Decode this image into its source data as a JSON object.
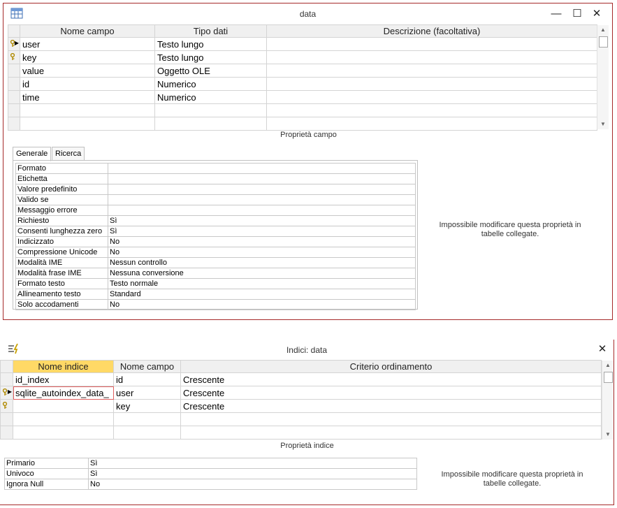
{
  "design_window": {
    "title": "data",
    "controls": {
      "minimize": "—",
      "maximize": "☐",
      "close": "✕"
    },
    "columns": [
      "Nome campo",
      "Tipo dati",
      "Descrizione (facoltativa)"
    ],
    "rows": [
      {
        "name": "user",
        "type": "Testo lungo",
        "desc": "",
        "key": true,
        "current": true
      },
      {
        "name": "key",
        "type": "Testo lungo",
        "desc": "",
        "key": true,
        "current": false
      },
      {
        "name": "value",
        "type": "Oggetto OLE",
        "desc": "",
        "key": false,
        "current": false
      },
      {
        "name": "id",
        "type": "Numerico",
        "desc": "",
        "key": false,
        "current": false
      },
      {
        "name": "time",
        "type": "Numerico",
        "desc": "",
        "key": false,
        "current": false
      },
      {
        "name": "",
        "type": "",
        "desc": "",
        "key": false,
        "current": false
      },
      {
        "name": "",
        "type": "",
        "desc": "",
        "key": false,
        "current": false
      }
    ],
    "section_label": "Proprietà campo",
    "tabs": [
      "Generale",
      "Ricerca"
    ],
    "properties": [
      [
        "Formato",
        ""
      ],
      [
        "Etichetta",
        ""
      ],
      [
        "Valore predefinito",
        ""
      ],
      [
        "Valido se",
        ""
      ],
      [
        "Messaggio errore",
        ""
      ],
      [
        "Richiesto",
        "Sì"
      ],
      [
        "Consenti lunghezza zero",
        "Sì"
      ],
      [
        "Indicizzato",
        "No"
      ],
      [
        "Compressione Unicode",
        "No"
      ],
      [
        "Modalità IME",
        "Nessun controllo"
      ],
      [
        "Modalità frase IME",
        "Nessuna conversione"
      ],
      [
        "Formato testo",
        "Testo normale"
      ],
      [
        "Allineamento testo",
        "Standard"
      ],
      [
        "Solo accodamenti",
        "No"
      ]
    ],
    "note": "Impossibile modificare questa proprietà in tabelle collegate."
  },
  "index_window": {
    "title": "Indici: data",
    "close": "✕",
    "columns": [
      "Nome indice",
      "Nome campo",
      "Criterio ordinamento"
    ],
    "rows": [
      {
        "index": "id_index",
        "field": "id",
        "order": "Crescente",
        "key": false,
        "current": false
      },
      {
        "index": "sqlite_autoindex_data_",
        "field": "user",
        "order": "Crescente",
        "key": true,
        "current": true
      },
      {
        "index": "",
        "field": "key",
        "order": "Crescente",
        "key": true,
        "current": false
      },
      {
        "index": "",
        "field": "",
        "order": "",
        "key": false,
        "current": false
      },
      {
        "index": "",
        "field": "",
        "order": "",
        "key": false,
        "current": false
      }
    ],
    "section_label": "Proprietà indice",
    "properties": [
      [
        "Primario",
        "Sì"
      ],
      [
        "Univoco",
        "Sì"
      ],
      [
        "Ignora Null",
        "No"
      ]
    ],
    "note": "Impossibile modificare questa proprietà in tabelle collegate.",
    "colors": {
      "selected_header": "#ffd966",
      "edit_outline": "#e06060"
    }
  }
}
